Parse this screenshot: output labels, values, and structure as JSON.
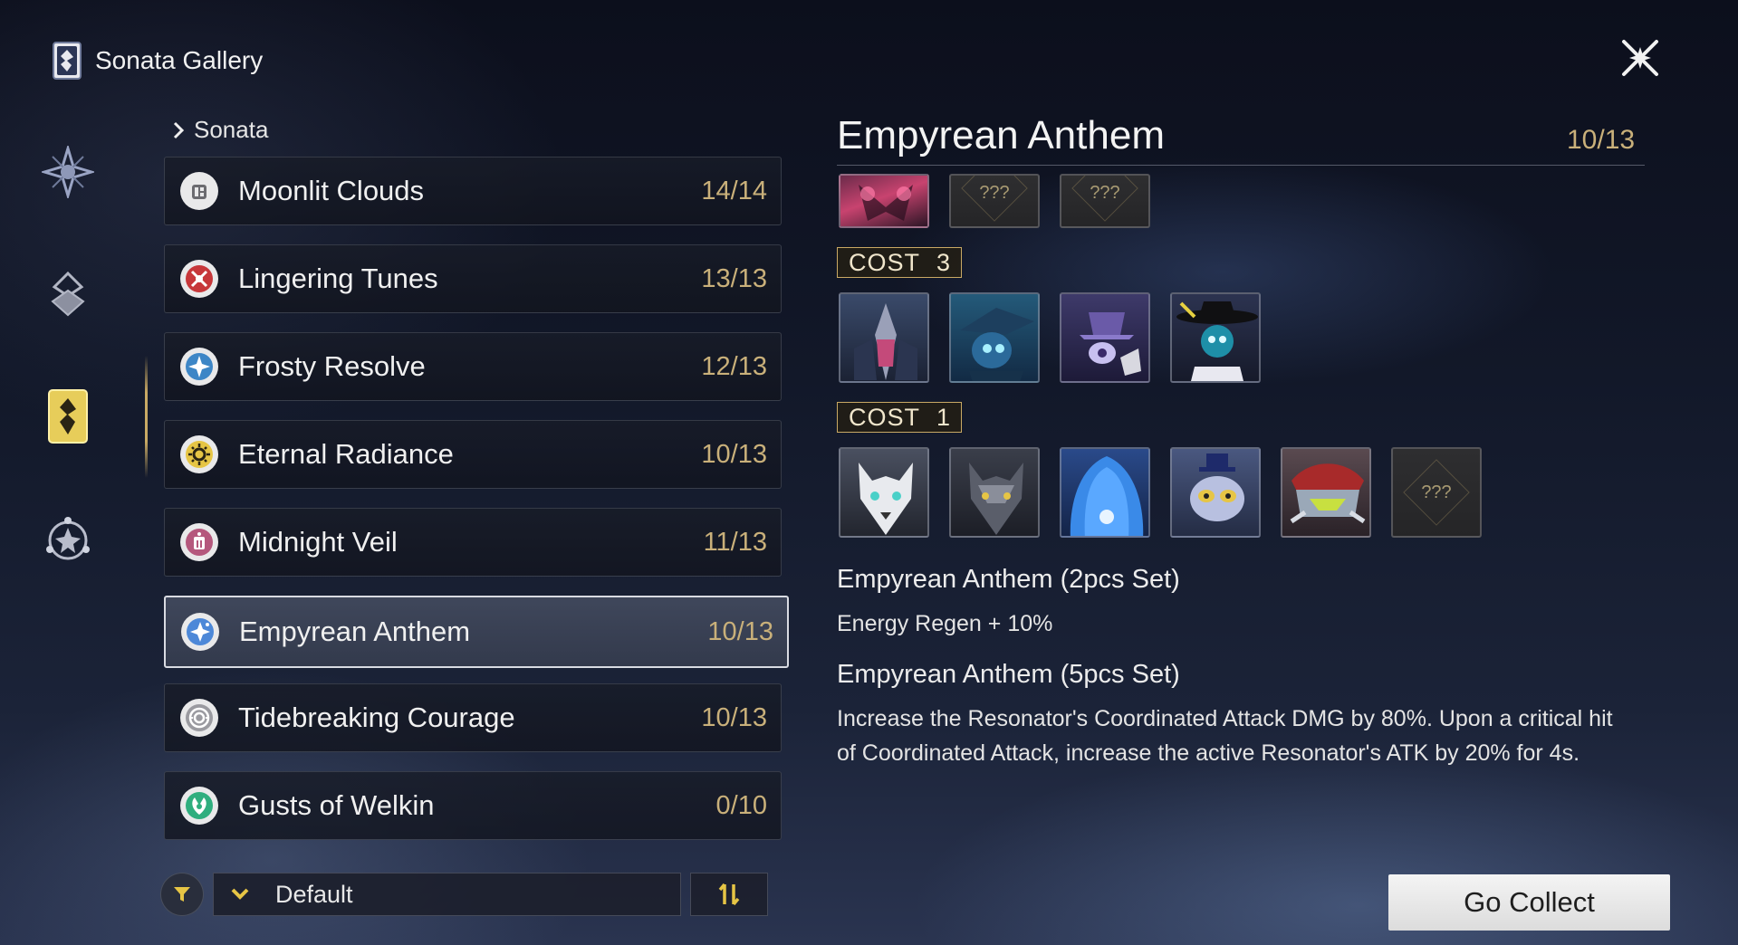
{
  "header": {
    "title": "Sonata Gallery"
  },
  "breadcrumb": {
    "label": "Sonata"
  },
  "sets": [
    {
      "name": "Moonlit Clouds",
      "count": "14/14",
      "icon": "moonlit-clouds-icon",
      "color": "#e9e9ea"
    },
    {
      "name": "Lingering Tunes",
      "count": "13/13",
      "icon": "lingering-tunes-icon",
      "color": "#c7373a"
    },
    {
      "name": "Frosty Resolve",
      "count": "12/13",
      "icon": "frosty-resolve-icon",
      "color": "#3d86c6"
    },
    {
      "name": "Eternal Radiance",
      "count": "10/13",
      "icon": "eternal-radiance-icon",
      "color": "#e6c545"
    },
    {
      "name": "Midnight Veil",
      "count": "11/13",
      "icon": "midnight-veil-icon",
      "color": "#b5587d"
    },
    {
      "name": "Empyrean Anthem",
      "count": "10/13",
      "icon": "empyrean-anthem-icon",
      "color": "#4d88d8",
      "selected": true
    },
    {
      "name": "Tidebreaking Courage",
      "count": "10/13",
      "icon": "tidebreaking-courage-icon",
      "color": "#9a9aa0"
    },
    {
      "name": "Gusts of Welkin",
      "count": "0/10",
      "icon": "gusts-of-welkin-icon",
      "color": "#2fae7e"
    }
  ],
  "filter": {
    "sort_label": "Default"
  },
  "detail": {
    "title": "Empyrean Anthem",
    "count": "10/13",
    "cost3_label": "COST",
    "cost3_value": "3",
    "cost1_label": "COST",
    "cost1_value": "1",
    "locked_label": "???",
    "two_piece_title": "Empyrean Anthem (2pcs Set)",
    "two_piece_text": "Energy Regen + 10%",
    "five_piece_title": "Empyrean Anthem (5pcs Set)",
    "five_piece_text": "Increase the Resonator's Coordinated Attack DMG by 80%. Upon a critical hit of Coordinated Attack, increase the active Resonator's ATK by 20% for 4s."
  },
  "actions": {
    "go_collect": "Go Collect"
  },
  "colors": {
    "accent_gold": "#c9b07a",
    "selected_border": "#d9dbe2"
  }
}
